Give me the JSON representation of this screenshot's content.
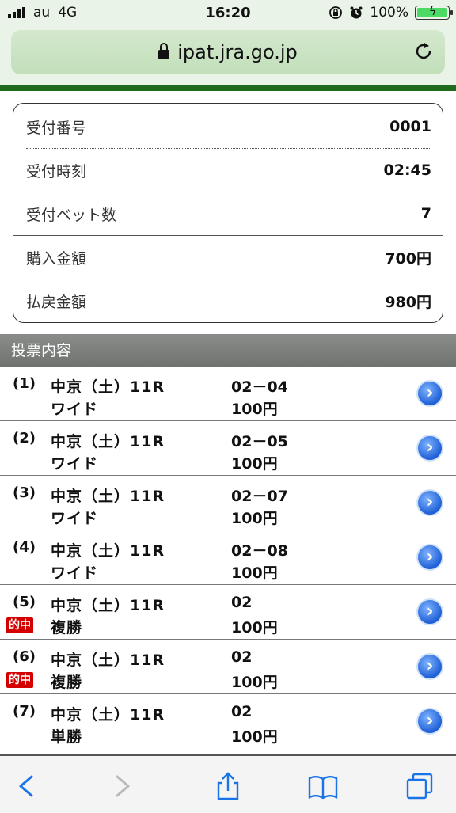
{
  "status_bar": {
    "carrier": "au",
    "network": "4G",
    "time": "16:20",
    "battery": "100%"
  },
  "browser": {
    "url": "ipat.jra.go.jp"
  },
  "receipt": [
    {
      "label": "受付番号",
      "value": "0001"
    },
    {
      "label": "受付時刻",
      "value": "02:45"
    },
    {
      "label": "受付ベット数",
      "value": "7"
    },
    {
      "label": "購入金額",
      "value": "700円"
    },
    {
      "label": "払戻金額",
      "value": "980円"
    }
  ],
  "section_title": "投票内容",
  "tickets": [
    {
      "index": "(1)",
      "race": "中京（土）11R",
      "bet_type": "ワイド",
      "numbers": "02－04",
      "amount": "100円",
      "hit": ""
    },
    {
      "index": "(2)",
      "race": "中京（土）11R",
      "bet_type": "ワイド",
      "numbers": "02－05",
      "amount": "100円",
      "hit": ""
    },
    {
      "index": "(3)",
      "race": "中京（土）11R",
      "bet_type": "ワイド",
      "numbers": "02－07",
      "amount": "100円",
      "hit": ""
    },
    {
      "index": "(4)",
      "race": "中京（土）11R",
      "bet_type": "ワイド",
      "numbers": "02－08",
      "amount": "100円",
      "hit": ""
    },
    {
      "index": "(5)",
      "race": "中京（土）11R",
      "bet_type": "複勝",
      "numbers": "02",
      "amount": "100円",
      "hit": "的中"
    },
    {
      "index": "(6)",
      "race": "中京（土）11R",
      "bet_type": "複勝",
      "numbers": "02",
      "amount": "100円",
      "hit": "的中"
    },
    {
      "index": "(7)",
      "race": "中京（土）11R",
      "bet_type": "単勝",
      "numbers": "02",
      "amount": "100円",
      "hit": ""
    }
  ],
  "colors": {
    "header_green": "#1e6b1e",
    "hit_red": "#d40000",
    "arrow_blue": "#1f5fd6"
  }
}
